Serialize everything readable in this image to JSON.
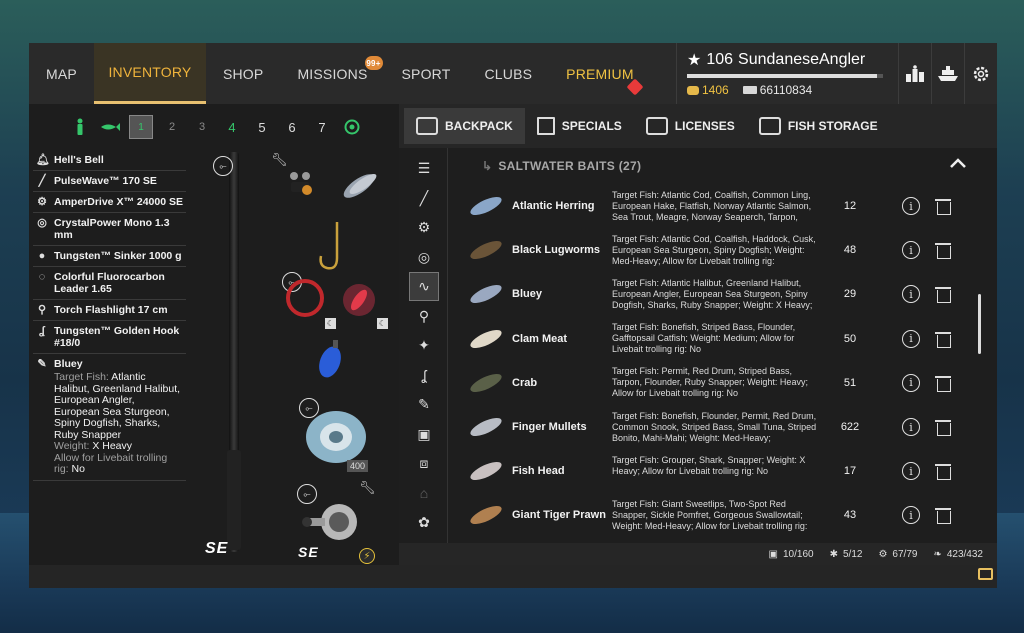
{
  "nav": {
    "tabs": [
      "MAP",
      "INVENTORY",
      "SHOP",
      "MISSIONS",
      "SPORT",
      "CLUBS",
      "PREMIUM"
    ],
    "missions_badge": "99+"
  },
  "player": {
    "level": "106",
    "name": "SundaneseAngler",
    "gold": "1406",
    "silver": "66110834",
    "xp_progress": 0.97
  },
  "top_icons": [
    "leaderboard-icon",
    "ship-icon",
    "settings-icon"
  ],
  "rod_slots": [
    "1",
    "2",
    "3",
    "4",
    "5",
    "6",
    "7"
  ],
  "gear": [
    {
      "name": "Hell's Bell",
      "icon": "bell-icon"
    },
    {
      "name": "PulseWave™ 170 SE",
      "icon": "rod-icon"
    },
    {
      "name": "AmperDrive X™ 24000 SE",
      "icon": "reel-icon"
    },
    {
      "name": "CrystalPower Mono 1.3 mm",
      "icon": "line-icon"
    },
    {
      "name": "Tungsten™ Sinker 1000 g",
      "icon": "sinker-icon"
    },
    {
      "name": "Colorful Fluorocarbon Leader 1.65",
      "icon": "leader-icon"
    },
    {
      "name": "Torch Flashlight 17 cm",
      "icon": "flashlight-icon"
    },
    {
      "name": "Tungsten™ Golden Hook #18/0",
      "icon": "hook-icon"
    }
  ],
  "selected_bait": {
    "name": "Bluey",
    "target_label": "Target Fish:",
    "target_value": "Atlantic Halibut, Greenland Halibut, European Angler, European Sea Sturgeon, Spiny Dogfish, Sharks, Ruby Snapper",
    "weight_label": "Weight:",
    "weight_value": "X Heavy",
    "livebait_label": "Allow for Livebait trolling rig:",
    "livebait_value": "No"
  },
  "rig": {
    "rod_brand": "SE",
    "reel_brand": "SE",
    "line_count": "400"
  },
  "tabs": [
    "BACKPACK",
    "SPECIALS",
    "LICENSES",
    "FISH STORAGE"
  ],
  "category_header": "SALTWATER BAITS (27)",
  "baits": [
    {
      "name": "Atlantic Herring",
      "desc": "Target Fish: Atlantic Cod, Coalfish, Common Ling, European Hake, Flatfish, Norway Atlantic Salmon, Sea Trout, Meagre, Norway Seaperch, Tarpon,",
      "qty": "12",
      "color": "#8aa6c8"
    },
    {
      "name": "Black Lugworms",
      "desc": "Target Fish: Atlantic Cod, Coalfish, Haddock, Cusk, European Sea Sturgeon, Spiny Dogfish; Weight: Med-Heavy; Allow for Livebait trolling rig:",
      "qty": "48",
      "color": "#6a5438"
    },
    {
      "name": "Bluey",
      "desc": "Target Fish: Atlantic Halibut, Greenland Halibut, European Angler, European Sea Sturgeon, Spiny Dogfish, Sharks, Ruby Snapper; Weight: X Heavy;",
      "qty": "29",
      "color": "#9aa8c0"
    },
    {
      "name": "Clam Meat",
      "desc": "Target Fish: Bonefish, Striped Bass, Flounder, Gafftopsail Catfish; Weight: Medium; Allow for Livebait trolling rig: No",
      "qty": "50",
      "color": "#e0d8c8"
    },
    {
      "name": "Crab",
      "desc": "Target Fish: Permit, Red Drum, Striped Bass, Tarpon, Flounder, Ruby Snapper; Weight: Heavy; Allow for Livebait trolling rig: No",
      "qty": "51",
      "color": "#5a6048"
    },
    {
      "name": "Finger Mullets",
      "desc": "Target Fish: Bonefish, Flounder, Permit, Red Drum, Common Snook, Striped Bass, Small Tuna, Striped Bonito, Mahi-Mahi; Weight: Med-Heavy;",
      "qty": "622",
      "color": "#b8bcc4"
    },
    {
      "name": "Fish Head",
      "desc": "Target Fish: Grouper, Shark, Snapper; Weight: X Heavy; Allow for Livebait trolling rig: No",
      "qty": "17",
      "color": "#c8c0c0"
    },
    {
      "name": "Giant Tiger Prawn",
      "desc": "Target Fish: Giant Sweetlips, Two-Spot Red Snapper, Sickle Pomfret, Gorgeous Swallowtail; Weight: Med-Heavy; Allow for Livebait trolling rig:",
      "qty": "43",
      "color": "#b08050"
    }
  ],
  "footer": {
    "backpack": "10/160",
    "rods": "5/12",
    "reels": "67/79",
    "baits": "423/432"
  }
}
